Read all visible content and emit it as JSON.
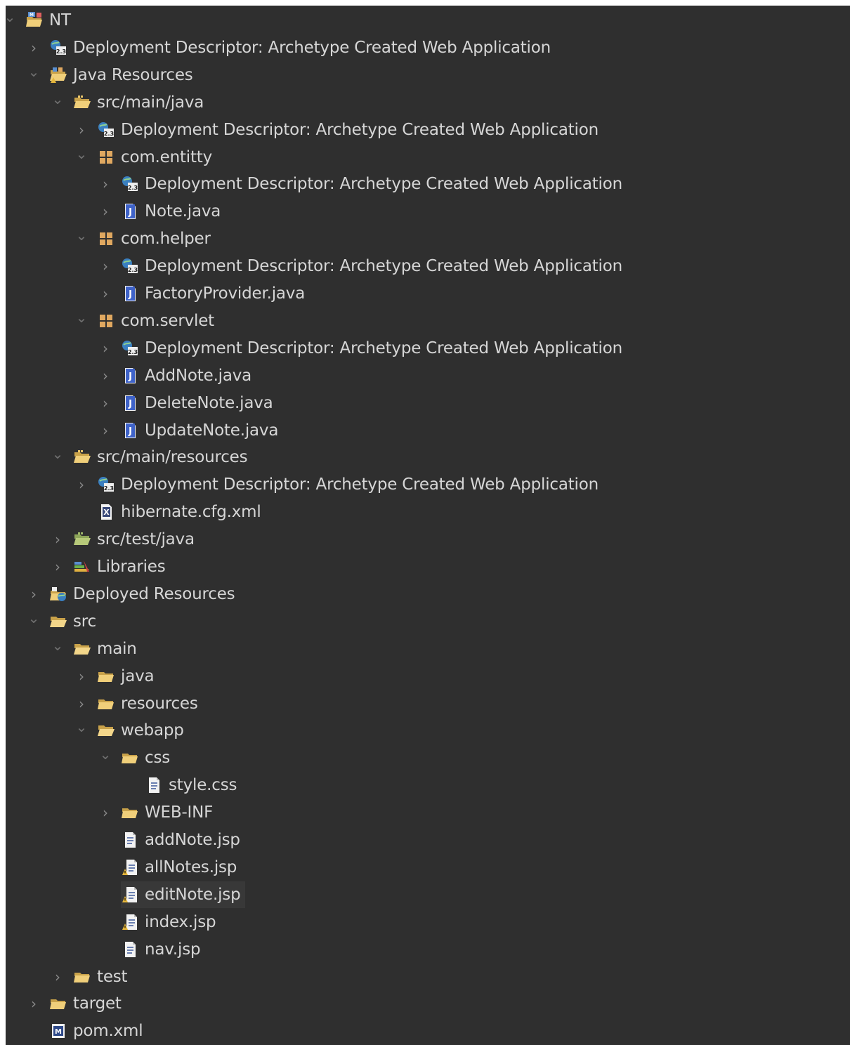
{
  "tree": {
    "items": [
      {
        "label": "NT",
        "level": 0,
        "chevron": "expanded",
        "icon": "project-icon"
      },
      {
        "label": "Deployment Descriptor: Archetype Created Web Application",
        "level": 1,
        "chevron": "collapsed",
        "icon": "deployment-descriptor-icon"
      },
      {
        "label": "Java Resources",
        "level": 1,
        "chevron": "expanded",
        "icon": "java-resources-icon"
      },
      {
        "label": "src/main/java",
        "level": 2,
        "chevron": "expanded",
        "icon": "source-folder-icon"
      },
      {
        "label": "Deployment Descriptor: Archetype Created Web Application",
        "level": 3,
        "chevron": "collapsed",
        "icon": "deployment-descriptor-icon"
      },
      {
        "label": "com.entitty",
        "level": 3,
        "chevron": "expanded",
        "icon": "package-icon"
      },
      {
        "label": "Deployment Descriptor: Archetype Created Web Application",
        "level": 4,
        "chevron": "collapsed",
        "icon": "deployment-descriptor-icon"
      },
      {
        "label": "Note.java",
        "level": 4,
        "chevron": "collapsed",
        "icon": "java-file-icon"
      },
      {
        "label": "com.helper",
        "level": 3,
        "chevron": "expanded",
        "icon": "package-icon"
      },
      {
        "label": "Deployment Descriptor: Archetype Created Web Application",
        "level": 4,
        "chevron": "collapsed",
        "icon": "deployment-descriptor-icon"
      },
      {
        "label": "FactoryProvider.java",
        "level": 4,
        "chevron": "collapsed",
        "icon": "java-file-icon"
      },
      {
        "label": "com.servlet",
        "level": 3,
        "chevron": "expanded",
        "icon": "package-icon"
      },
      {
        "label": "Deployment Descriptor: Archetype Created Web Application",
        "level": 4,
        "chevron": "collapsed",
        "icon": "deployment-descriptor-icon"
      },
      {
        "label": "AddNote.java",
        "level": 4,
        "chevron": "collapsed",
        "icon": "java-file-icon"
      },
      {
        "label": "DeleteNote.java",
        "level": 4,
        "chevron": "collapsed",
        "icon": "java-file-icon"
      },
      {
        "label": "UpdateNote.java",
        "level": 4,
        "chevron": "collapsed",
        "icon": "java-file-icon"
      },
      {
        "label": "src/main/resources",
        "level": 2,
        "chevron": "expanded",
        "icon": "source-folder-icon"
      },
      {
        "label": "Deployment Descriptor: Archetype Created Web Application",
        "level": 3,
        "chevron": "collapsed",
        "icon": "deployment-descriptor-icon"
      },
      {
        "label": "hibernate.cfg.xml",
        "level": 3,
        "chevron": "none",
        "icon": "xml-file-icon"
      },
      {
        "label": "src/test/java",
        "level": 2,
        "chevron": "collapsed",
        "icon": "test-source-folder-icon"
      },
      {
        "label": "Libraries",
        "level": 2,
        "chevron": "collapsed",
        "icon": "libraries-icon"
      },
      {
        "label": "Deployed Resources",
        "level": 1,
        "chevron": "collapsed",
        "icon": "deployed-resources-icon"
      },
      {
        "label": "src",
        "level": 1,
        "chevron": "expanded",
        "icon": "folder-open-icon"
      },
      {
        "label": "main",
        "level": 2,
        "chevron": "expanded",
        "icon": "folder-open-icon"
      },
      {
        "label": "java",
        "level": 3,
        "chevron": "collapsed",
        "icon": "folder-icon"
      },
      {
        "label": "resources",
        "level": 3,
        "chevron": "collapsed",
        "icon": "folder-icon"
      },
      {
        "label": "webapp",
        "level": 3,
        "chevron": "expanded",
        "icon": "folder-open-icon"
      },
      {
        "label": "css",
        "level": 4,
        "chevron": "expanded",
        "icon": "folder-icon"
      },
      {
        "label": "style.css",
        "level": 5,
        "chevron": "none",
        "icon": "css-file-icon"
      },
      {
        "label": "WEB-INF",
        "level": 4,
        "chevron": "collapsed",
        "icon": "folder-icon"
      },
      {
        "label": "addNote.jsp",
        "level": 4,
        "chevron": "none",
        "icon": "jsp-file-icon"
      },
      {
        "label": "allNotes.jsp",
        "level": 4,
        "chevron": "none",
        "icon": "jsp-file-modified-icon"
      },
      {
        "label": "editNote.jsp",
        "level": 4,
        "chevron": "none",
        "icon": "jsp-file-modified-icon",
        "selected": true
      },
      {
        "label": "index.jsp",
        "level": 4,
        "chevron": "none",
        "icon": "jsp-file-modified-icon"
      },
      {
        "label": "nav.jsp",
        "level": 4,
        "chevron": "none",
        "icon": "jsp-file-icon"
      },
      {
        "label": "test",
        "level": 2,
        "chevron": "collapsed",
        "icon": "folder-icon"
      },
      {
        "label": "target",
        "level": 1,
        "chevron": "collapsed",
        "icon": "folder-icon"
      },
      {
        "label": "pom.xml",
        "level": 1,
        "chevron": "none",
        "icon": "maven-pom-icon"
      }
    ]
  },
  "colors": {
    "background": "#2f2f2f",
    "text": "#d6d6d6",
    "chevron": "#8a8a8a",
    "selection": "#383838",
    "folder": "#e8c46a",
    "java_file": "#3f63c9"
  }
}
